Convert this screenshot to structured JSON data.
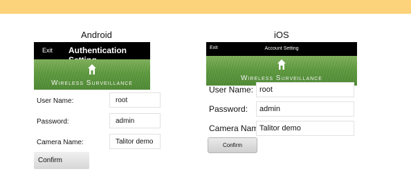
{
  "android": {
    "platform_label": "Android",
    "header": {
      "exit_label": "Exit",
      "title": "Authentication Setting"
    },
    "banner": {
      "icon": "home-icon",
      "brand": "Wireless Surveillance"
    },
    "form": {
      "user_label": "User Name:",
      "user_value": "root",
      "password_label": "Password:",
      "password_value": "admin",
      "camera_label": "Camera Name:",
      "camera_value": "Talitor demo"
    },
    "confirm_label": "Confirm"
  },
  "ios": {
    "platform_label": "iOS",
    "header": {
      "exit_label": "Exit",
      "title": "Account Setting"
    },
    "banner": {
      "icon": "home-icon",
      "brand": "Wireless Surveillance"
    },
    "form": {
      "user_label": "User Name:",
      "user_value": "root",
      "password_label": "Password:",
      "password_value": "admin",
      "camera_label": "Camera Name:",
      "camera_value": "Talitor demo"
    },
    "confirm_label": "Confirm"
  },
  "colors": {
    "top_bar": "#fcd27a",
    "header": "#000000",
    "grass": "#5e9a3e"
  }
}
